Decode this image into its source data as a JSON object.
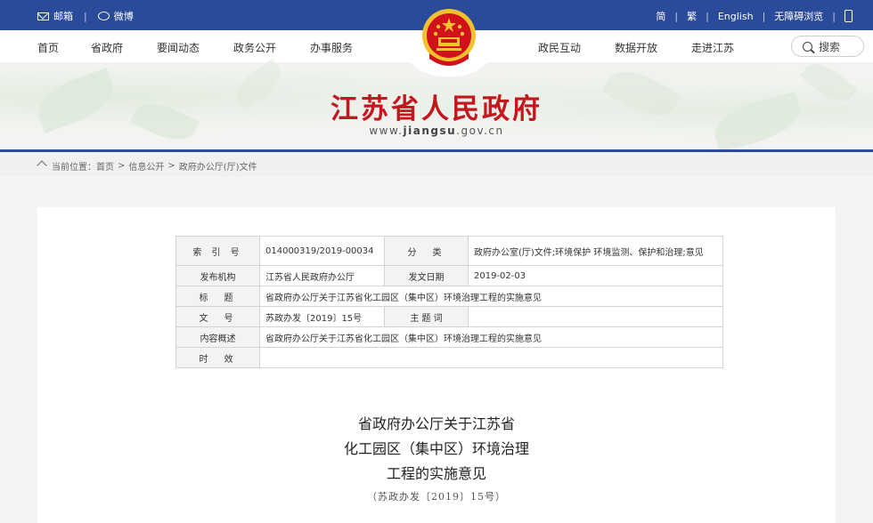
{
  "topbar": {
    "mail_label": "邮箱",
    "weibo_label": "微博",
    "simplified_label": "简",
    "traditional_label": "繁",
    "english_label": "English",
    "accessibility_label": "无障碍浏览"
  },
  "nav": {
    "items": [
      "首页",
      "省政府",
      "要闻动态",
      "政务公开",
      "办事服务",
      "政民互动",
      "数据开放",
      "走进江苏"
    ],
    "search_label": "搜索"
  },
  "banner": {
    "title": "江苏省人民政府",
    "url_prefix": "www.",
    "url_domain": "jiangsu",
    "url_suffix": ".gov.cn"
  },
  "breadcrumb": {
    "prefix": "当前位置：",
    "items": [
      "首页",
      "信息公开",
      "政府办公厅(厅)文件"
    ]
  },
  "meta_table": {
    "index_label": "索 引 号",
    "index_value": "014000319/2019-00034",
    "category_label": "分　类",
    "category_value": "政府办公室(厅)文件;环境保护 环境监测、保护和治理;意见",
    "issuer_label": "发布机构",
    "issuer_value": "江苏省人民政府办公厅",
    "date_label": "发文日期",
    "date_value": "2019-02-03",
    "title_label": "标　题",
    "title_value": "省政府办公厅关于江苏省化工园区（集中区）环境治理工程的实施意见",
    "docno_label": "文　号",
    "docno_value": "苏政办发〔2019〕15号",
    "keywords_label": "主 题 词",
    "keywords_value": "",
    "summary_label": "内容概述",
    "summary_value": "省政府办公厅关于江苏省化工园区（集中区）环境治理工程的实施意见",
    "validity_label": "时　效",
    "validity_value": ""
  },
  "document": {
    "title_line1": "省政府办公厅关于江苏省",
    "title_line2": "化工园区（集中区）环境治理",
    "title_line3": "工程的实施意见",
    "doc_number": "（苏政办发〔2019〕15号）"
  },
  "colors": {
    "topbar_blue": "#2a4a9a",
    "title_red": "#c4161c",
    "emblem_red": "#d0131a",
    "emblem_gold": "#f2c230"
  }
}
